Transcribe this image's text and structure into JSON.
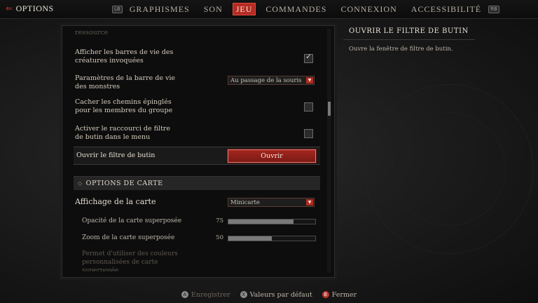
{
  "header": {
    "back_label": "OPTIONS",
    "left_bumper": "LB",
    "right_bumper": "RB",
    "tabs": [
      {
        "label": "GRAPHISMES"
      },
      {
        "label": "SON"
      },
      {
        "label": "JEU"
      },
      {
        "label": "COMMANDES"
      },
      {
        "label": "CONNEXION"
      },
      {
        "label": "ACCESSIBILITÉ"
      }
    ],
    "active_tab": "JEU"
  },
  "settings": {
    "faded_top": "ressource",
    "summon_health": {
      "label": "Afficher les barres de vie des créatures invoquées",
      "checked": true
    },
    "monster_health": {
      "label": "Paramètres de la barre de vie des monstres",
      "value": "Au passage de la souris"
    },
    "hide_pins": {
      "label": "Cacher les chemins épinglés pour les membres du groupe",
      "checked": false
    },
    "loot_filter_shortcut": {
      "label": "Activer le raccourci de filtre de butin dans le menu",
      "checked": false
    },
    "open_loot_filter": {
      "label": "Ouvrir le filtre de butin",
      "button": "Ouvrir"
    }
  },
  "map_section": {
    "title": "OPTIONS DE CARTE",
    "map_display": {
      "label": "Affichage de la carte",
      "value": "Minicarte"
    },
    "overlay_opacity": {
      "label": "Opacité de la carte superposée",
      "value": "75",
      "fraction": 0.75
    },
    "overlay_zoom": {
      "label": "Zoom de la carte superposée",
      "value": "50",
      "fraction": 0.5
    },
    "custom_colors_faded": "Permet d'utiliser des couleurs personnalisées de carte superposée"
  },
  "description": {
    "title": "OUVRIR LE FILTRE DE BUTIN",
    "text": "Ouvre la fenêtre de filtre de butin."
  },
  "footer": {
    "save": {
      "icon": "A",
      "label": "Enregistrer"
    },
    "defaults": {
      "icon": "X",
      "label": "Valeurs par défaut"
    },
    "close": {
      "icon": "B",
      "label": "Fermer"
    }
  },
  "colors": {
    "accent": "#b52b22",
    "panel": "#0d0d0d"
  }
}
